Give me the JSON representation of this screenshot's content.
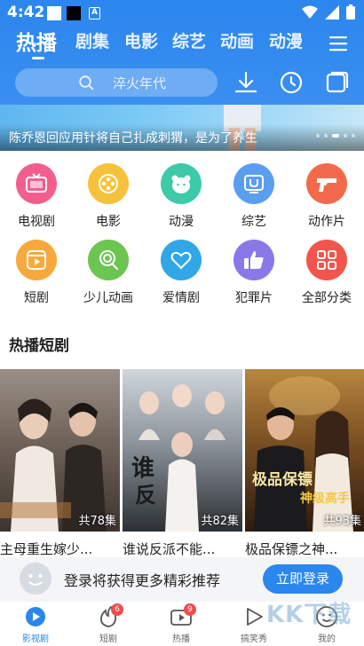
{
  "status_bar": {
    "time": "4:42",
    "a_icon": "A"
  },
  "header": {
    "tabs": [
      "热播",
      "剧集",
      "电影",
      "综艺",
      "动画",
      "动漫"
    ],
    "active_tab": "热播",
    "search_placeholder": "淬火年代"
  },
  "banner": {
    "caption": "陈乔恩回应用针将自己扎成刺猬，是为了养生"
  },
  "categories": [
    {
      "label": "电视剧",
      "color": "#f25f8d",
      "icon": "tv-icon"
    },
    {
      "label": "电影",
      "color": "#f7c23b",
      "icon": "film-reel-icon"
    },
    {
      "label": "动漫",
      "color": "#3ccaa9",
      "icon": "bear-icon"
    },
    {
      "label": "综艺",
      "color": "#5b9ef0",
      "icon": "variety-icon"
    },
    {
      "label": "动作片",
      "color": "#f26a4b",
      "icon": "gun-icon"
    },
    {
      "label": "短剧",
      "color": "#f7a93b",
      "icon": "play-square-icon"
    },
    {
      "label": "少儿动画",
      "color": "#6cc451",
      "icon": "lollipop-icon"
    },
    {
      "label": "爱情剧",
      "color": "#31a7e8",
      "icon": "heart-icon"
    },
    {
      "label": "犯罪片",
      "color": "#8b78e8",
      "icon": "thumb-icon"
    },
    {
      "label": "全部分类",
      "color": "#f2554b",
      "icon": "grid-icon"
    }
  ],
  "section": {
    "title": "热播短剧"
  },
  "cards": [
    {
      "title": "主母重生嫁少...",
      "episodes": "共78集"
    },
    {
      "title": "谁说反派不能...",
      "episodes": "共82集"
    },
    {
      "title": "极品保镖之神...",
      "episodes": "共93集"
    }
  ],
  "login": {
    "text": "登录将获得更多精彩推荐",
    "button": "立即登录"
  },
  "bottom_nav": [
    {
      "label": "影视剧",
      "badge": ""
    },
    {
      "label": "短剧",
      "badge": "6"
    },
    {
      "label": "热播",
      "badge": "9"
    },
    {
      "label": "搞笑秀",
      "badge": ""
    },
    {
      "label": "我的",
      "badge": ""
    }
  ],
  "watermark": "KK下载",
  "colors": {
    "primary": "#2b86ee",
    "badge": "#f24b4b"
  }
}
